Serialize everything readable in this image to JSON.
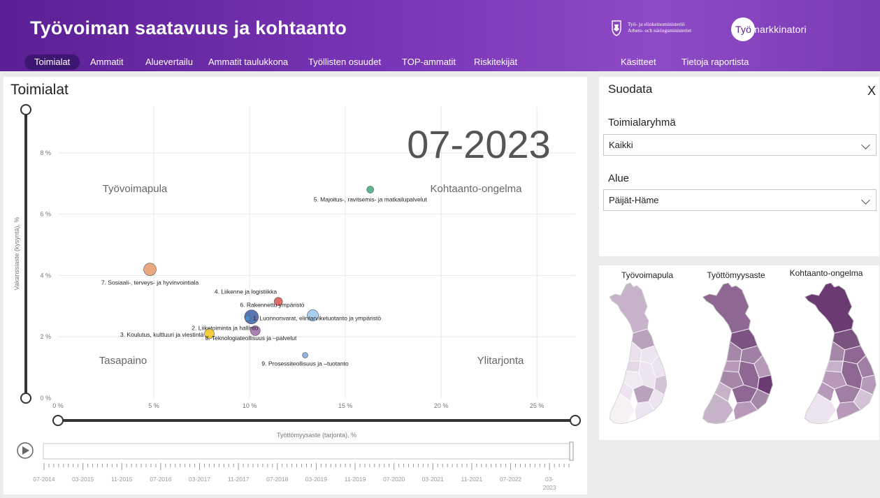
{
  "header": {
    "title": "Työvoiman saatavuus ja kohtaanto",
    "ministry_line1": "Työ- ja elinkeinoministeriö",
    "ministry_line2": "Arbets- och näringsministeriet",
    "brand_first": "Työ",
    "brand_rest": "markkinatori"
  },
  "nav": {
    "items": [
      "Toimialat",
      "Ammatit",
      "Aluevertailu",
      "Ammatit taulukkona",
      "Työllisten osuudet",
      "TOP-ammatit",
      "Riskitekijät",
      "Käsitteet",
      "Tietoja raportista"
    ],
    "active": "Toimialat"
  },
  "main": {
    "title": "Toimialat",
    "period": "07-2023",
    "quadrants": {
      "top_left": "Työvoimapula",
      "top_right": "Kohtaanto-ongelma",
      "bottom_left": "Tasapaino",
      "bottom_right": "Ylitarjonta"
    }
  },
  "chart_data": {
    "type": "scatter",
    "xlabel": "Työttömyysaste (tarjonta), %",
    "ylabel": "Vakanssiaste (kysyntä), %",
    "xlim": [
      0,
      27
    ],
    "ylim": [
      0,
      9.5
    ],
    "x_ticks": [
      "0 %",
      "5 %",
      "10 %",
      "15 %",
      "20 %",
      "25 %"
    ],
    "y_ticks": [
      "0 %",
      "2 %",
      "4 %",
      "6 %",
      "8 %"
    ],
    "points": [
      {
        "label": "5. Majoitus-, ravitsemis- ja matkailupalvelut",
        "x": 16.3,
        "y": 6.8,
        "color": "#3daa7a",
        "size": 5
      },
      {
        "label": "7. Sosiaali-, terveys- ja hyvinvointiala",
        "x": 4.8,
        "y": 4.2,
        "color": "#e59a6a",
        "size": 9
      },
      {
        "label": "4. Liikenne ja logistiikka",
        "x": 11.5,
        "y": 3.15,
        "color": "#d9534f",
        "size": 6
      },
      {
        "label": "6. Rakennettu ympäristö",
        "x": 13.3,
        "y": 2.7,
        "color": "#9cc7ee",
        "size": 8
      },
      {
        "label": "1. Luonnonvarat, elintarviketuotanto ja ympäristö",
        "x": 10.1,
        "y": 2.65,
        "color": "#3d5fa8",
        "size": 10
      },
      {
        "label": "2. Liiketoiminta ja hallinto",
        "x": 10.3,
        "y": 2.2,
        "color": "#9d6aa8",
        "size": 7
      },
      {
        "label": "3. Koulutus, kulttuuri ja viestintä",
        "x": 7.9,
        "y": 2.1,
        "color": "#f2c21b",
        "size": 7
      },
      {
        "label": "8. Teknologiateollisuus ja –palvelut",
        "x": 9.9,
        "y": 2.6,
        "color": "#4a8fd8",
        "size": 4
      },
      {
        "label": "9. Prosessiteollisuus ja –tuotanto",
        "x": 12.9,
        "y": 1.4,
        "color": "#7ea6e0",
        "size": 4
      }
    ]
  },
  "timeline": {
    "ticks": [
      "07-2014",
      "03-2015",
      "11-2015",
      "07-2016",
      "03-2017",
      "11-2017",
      "07-2018",
      "03-2019",
      "11-2019",
      "07-2020",
      "03-2021",
      "11-2021",
      "07-2022",
      "03-2023"
    ],
    "play_icon": "play-icon"
  },
  "filters": {
    "title": "Suodata",
    "close": "X",
    "group_label": "Toimialaryhmä",
    "group_value": "Kaikki",
    "area_label": "Alue",
    "area_value": "Päijät-Häme"
  },
  "maps": {
    "titles": [
      "Työvoimapula",
      "Työttömyysaste",
      "Kohtaanto-ongelma"
    ]
  },
  "colors": {
    "accent": "#5b1f93",
    "nav_active": "#3c1670",
    "map_light": "#ece4ee",
    "map_dark": "#6b3a73"
  }
}
